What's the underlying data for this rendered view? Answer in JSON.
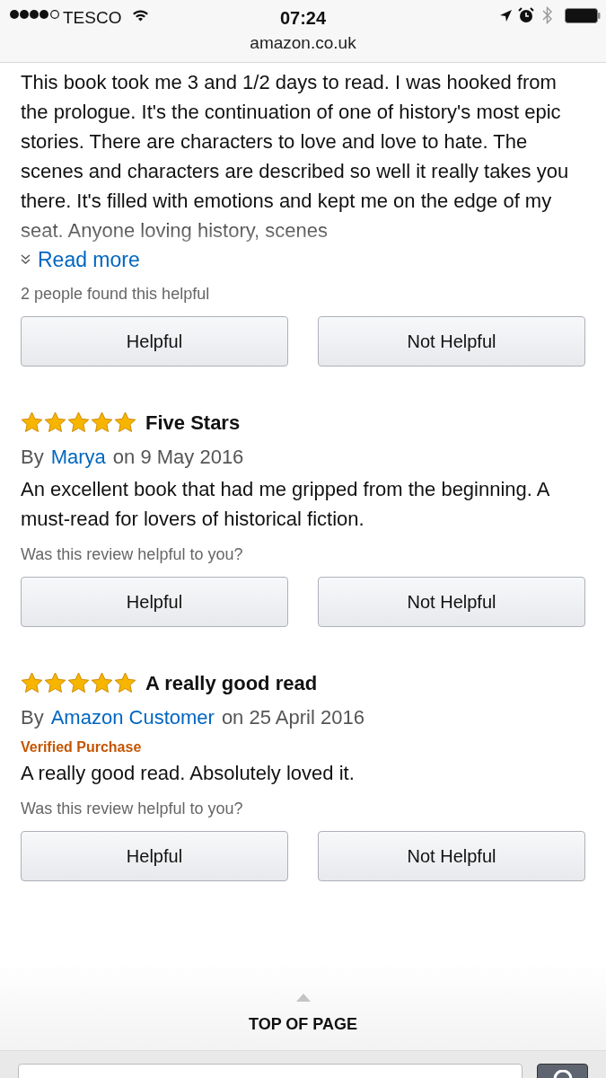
{
  "status_bar": {
    "carrier": "TESCO",
    "time": "07:24",
    "url": "amazon.co.uk"
  },
  "reviews": [
    {
      "text": "This book took me 3 and 1/2 days to read. I was hooked from the prologue. It's the continuation of one of history's most epic stories. There are characters to love and love to hate. The scenes and characters are described so well it really takes you there. It's filled with emotions and kept me on the edge of my seat. Anyone loving history, scenes",
      "faded": true,
      "read_more": "Read more",
      "helpful_text": "2 people found this helpful",
      "buttons": [
        "Helpful",
        "Not Helpful"
      ]
    },
    {
      "stars": 5,
      "title": "Five Stars",
      "by": "By",
      "author": "Marya",
      "date": "on 9 May 2016",
      "text": "An excellent book that had me gripped from the beginning. A must-read for lovers of historical fiction.",
      "faded": false,
      "helpful_text": "Was this review helpful to you?",
      "buttons": [
        "Helpful",
        "Not Helpful"
      ]
    },
    {
      "stars": 5,
      "title": "A really good read",
      "by": "By",
      "author": "Amazon Customer",
      "date": "on 25 April 2016",
      "verified": "Verified Purchase",
      "text": "A really good read. Absolutely loved it.",
      "faded": false,
      "helpful_text": "Was this review helpful to you?",
      "buttons": [
        "Helpful",
        "Not Helpful"
      ]
    }
  ],
  "footer": {
    "top_of_page": "TOP OF PAGE"
  }
}
